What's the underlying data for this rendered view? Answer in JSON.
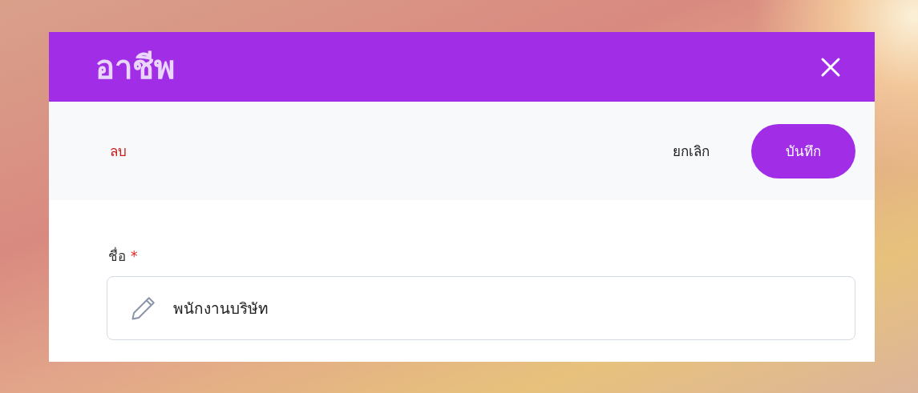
{
  "dialog": {
    "title": "อาชีพ"
  },
  "toolbar": {
    "buttons": [
      {
        "label": "ลบ",
        "kind": "danger"
      },
      {
        "label": "ยกเลิก",
        "kind": "plain"
      },
      {
        "label": "บันทึก",
        "kind": "primary"
      }
    ]
  },
  "form": {
    "fields": [
      {
        "label": "ชื่อ",
        "required": true,
        "required_mark": "*",
        "value": "พนักงานบริษัท"
      }
    ]
  }
}
